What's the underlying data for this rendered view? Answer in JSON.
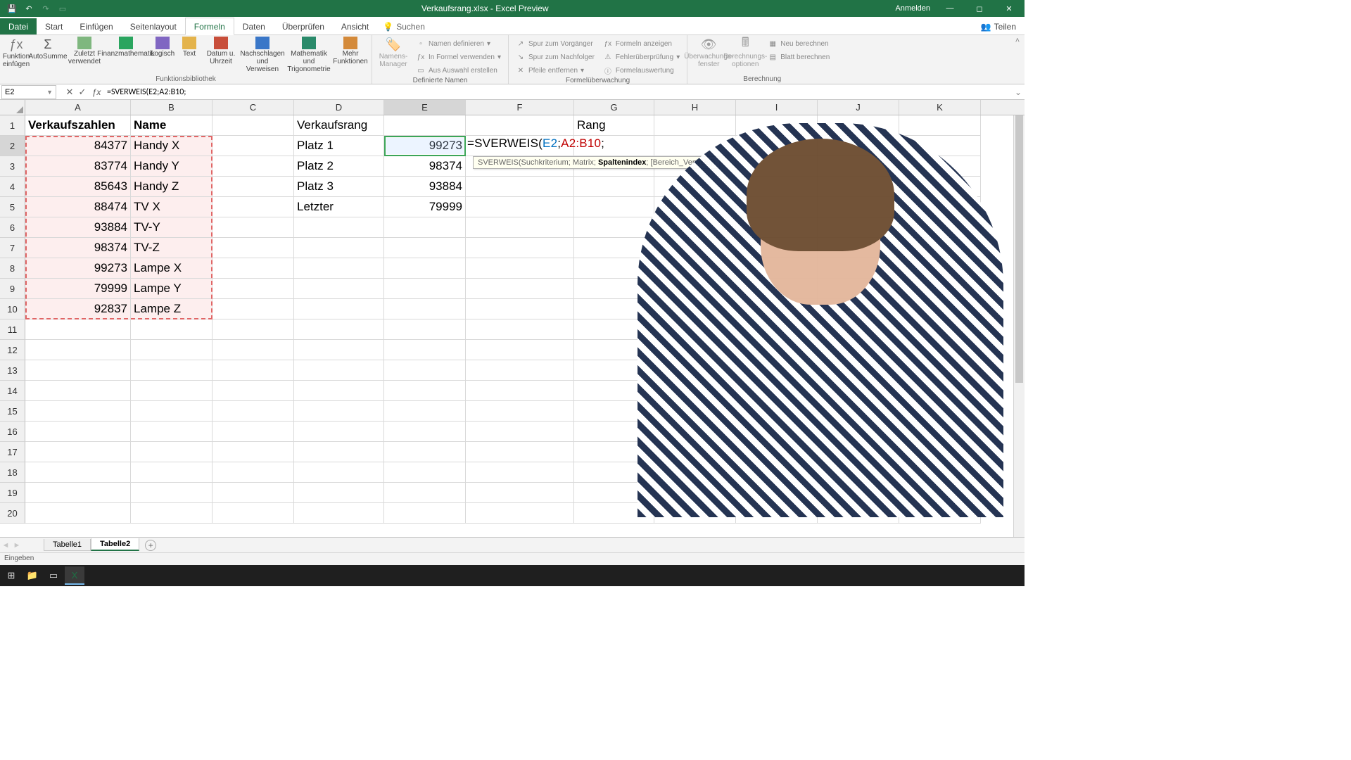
{
  "titlebar": {
    "title": "Verkaufsrang.xlsx - Excel Preview",
    "signin": "Anmelden"
  },
  "tabs": {
    "file": "Datei",
    "home": "Start",
    "insert": "Einfügen",
    "layout": "Seitenlayout",
    "formulas": "Formeln",
    "data": "Daten",
    "review": "Überprüfen",
    "view": "Ansicht",
    "search": "Suchen",
    "share": "Teilen"
  },
  "ribbon": {
    "lib": {
      "fx": "Funktion einfügen",
      "autosum": "AutoSumme",
      "recent": "Zuletzt verwendet",
      "financial": "Finanzmathematik",
      "logical": "Logisch",
      "text": "Text",
      "datetime": "Datum u. Uhrzeit",
      "lookup": "Nachschlagen und Verweisen",
      "math": "Mathematik und Trigonometrie",
      "more": "Mehr Funktionen",
      "label": "Funktionsbibliothek"
    },
    "names": {
      "mgr": "Namens-Manager",
      "def": "Namen definieren",
      "use": "In Formel verwenden",
      "sel": "Aus Auswahl erstellen",
      "label": "Definierte Namen"
    },
    "audit": {
      "pre": "Spur zum Vorgänger",
      "dep": "Spur zum Nachfolger",
      "rem": "Pfeile entfernen",
      "show": "Formeln anzeigen",
      "err": "Fehlerüberprüfung",
      "eval": "Formelauswertung",
      "label": "Formelüberwachung"
    },
    "calc": {
      "watch": "Überwachungs-fenster",
      "opts": "Berechnungs-optionen",
      "now": "Neu berechnen",
      "sheet": "Blatt berechnen",
      "label": "Berechnung"
    }
  },
  "namebox": "E2",
  "formula": "=SVERWEIS(E2;A2:B10;",
  "col_headers": [
    "A",
    "B",
    "C",
    "D",
    "E",
    "F",
    "G",
    "H",
    "I",
    "J",
    "K"
  ],
  "cells": {
    "A1": "Verkaufszahlen",
    "B1": "Name",
    "A2": "84377",
    "B2": "Handy X",
    "A3": "83774",
    "B3": "Handy Y",
    "A4": "85643",
    "B4": "Handy Z",
    "A5": "88474",
    "B5": "TV X",
    "A6": "93884",
    "B6": "TV-Y",
    "A7": "98374",
    "B7": "TV-Z",
    "A8": "99273",
    "B8": "Lampe X",
    "A9": "79999",
    "B9": "Lampe Y",
    "A10": "92837",
    "B10": "Lampe Z",
    "D1": "Verkaufsrang",
    "D2": "Platz 1",
    "E2": "99273",
    "D3": "Platz 2",
    "E3": "98374",
    "D4": "Platz 3",
    "E4": "93884",
    "D5": "Letzter",
    "E5": "79999",
    "G1": "Rang"
  },
  "formula_parts": {
    "fn": "=SVERWEIS(",
    "a1": "E2",
    "sep1": ";",
    "a2": "A2:B10",
    "sep2": ";"
  },
  "tooltip": {
    "pre": "SVERWEIS(Suchkriterium; Matrix; ",
    "bold": "Spaltenindex",
    "post": "; [Bereich_Verweis])"
  },
  "sheets": {
    "s1": "Tabelle1",
    "s2": "Tabelle2"
  },
  "status": "Eingeben"
}
